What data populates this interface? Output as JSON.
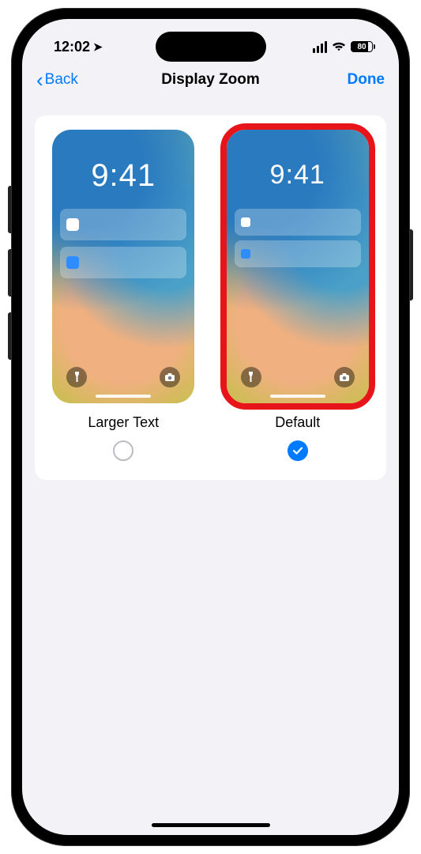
{
  "status": {
    "time": "12:02",
    "battery_pct": "80"
  },
  "nav": {
    "back_label": "Back",
    "title": "Display Zoom",
    "done_label": "Done"
  },
  "options": [
    {
      "key": "larger",
      "label": "Larger Text",
      "preview_time": "9:41",
      "selected": false,
      "highlighted": false
    },
    {
      "key": "default",
      "label": "Default",
      "preview_time": "9:41",
      "selected": true,
      "highlighted": true
    }
  ],
  "colors": {
    "accent": "#007aff",
    "highlight_ring": "#e7151a"
  }
}
